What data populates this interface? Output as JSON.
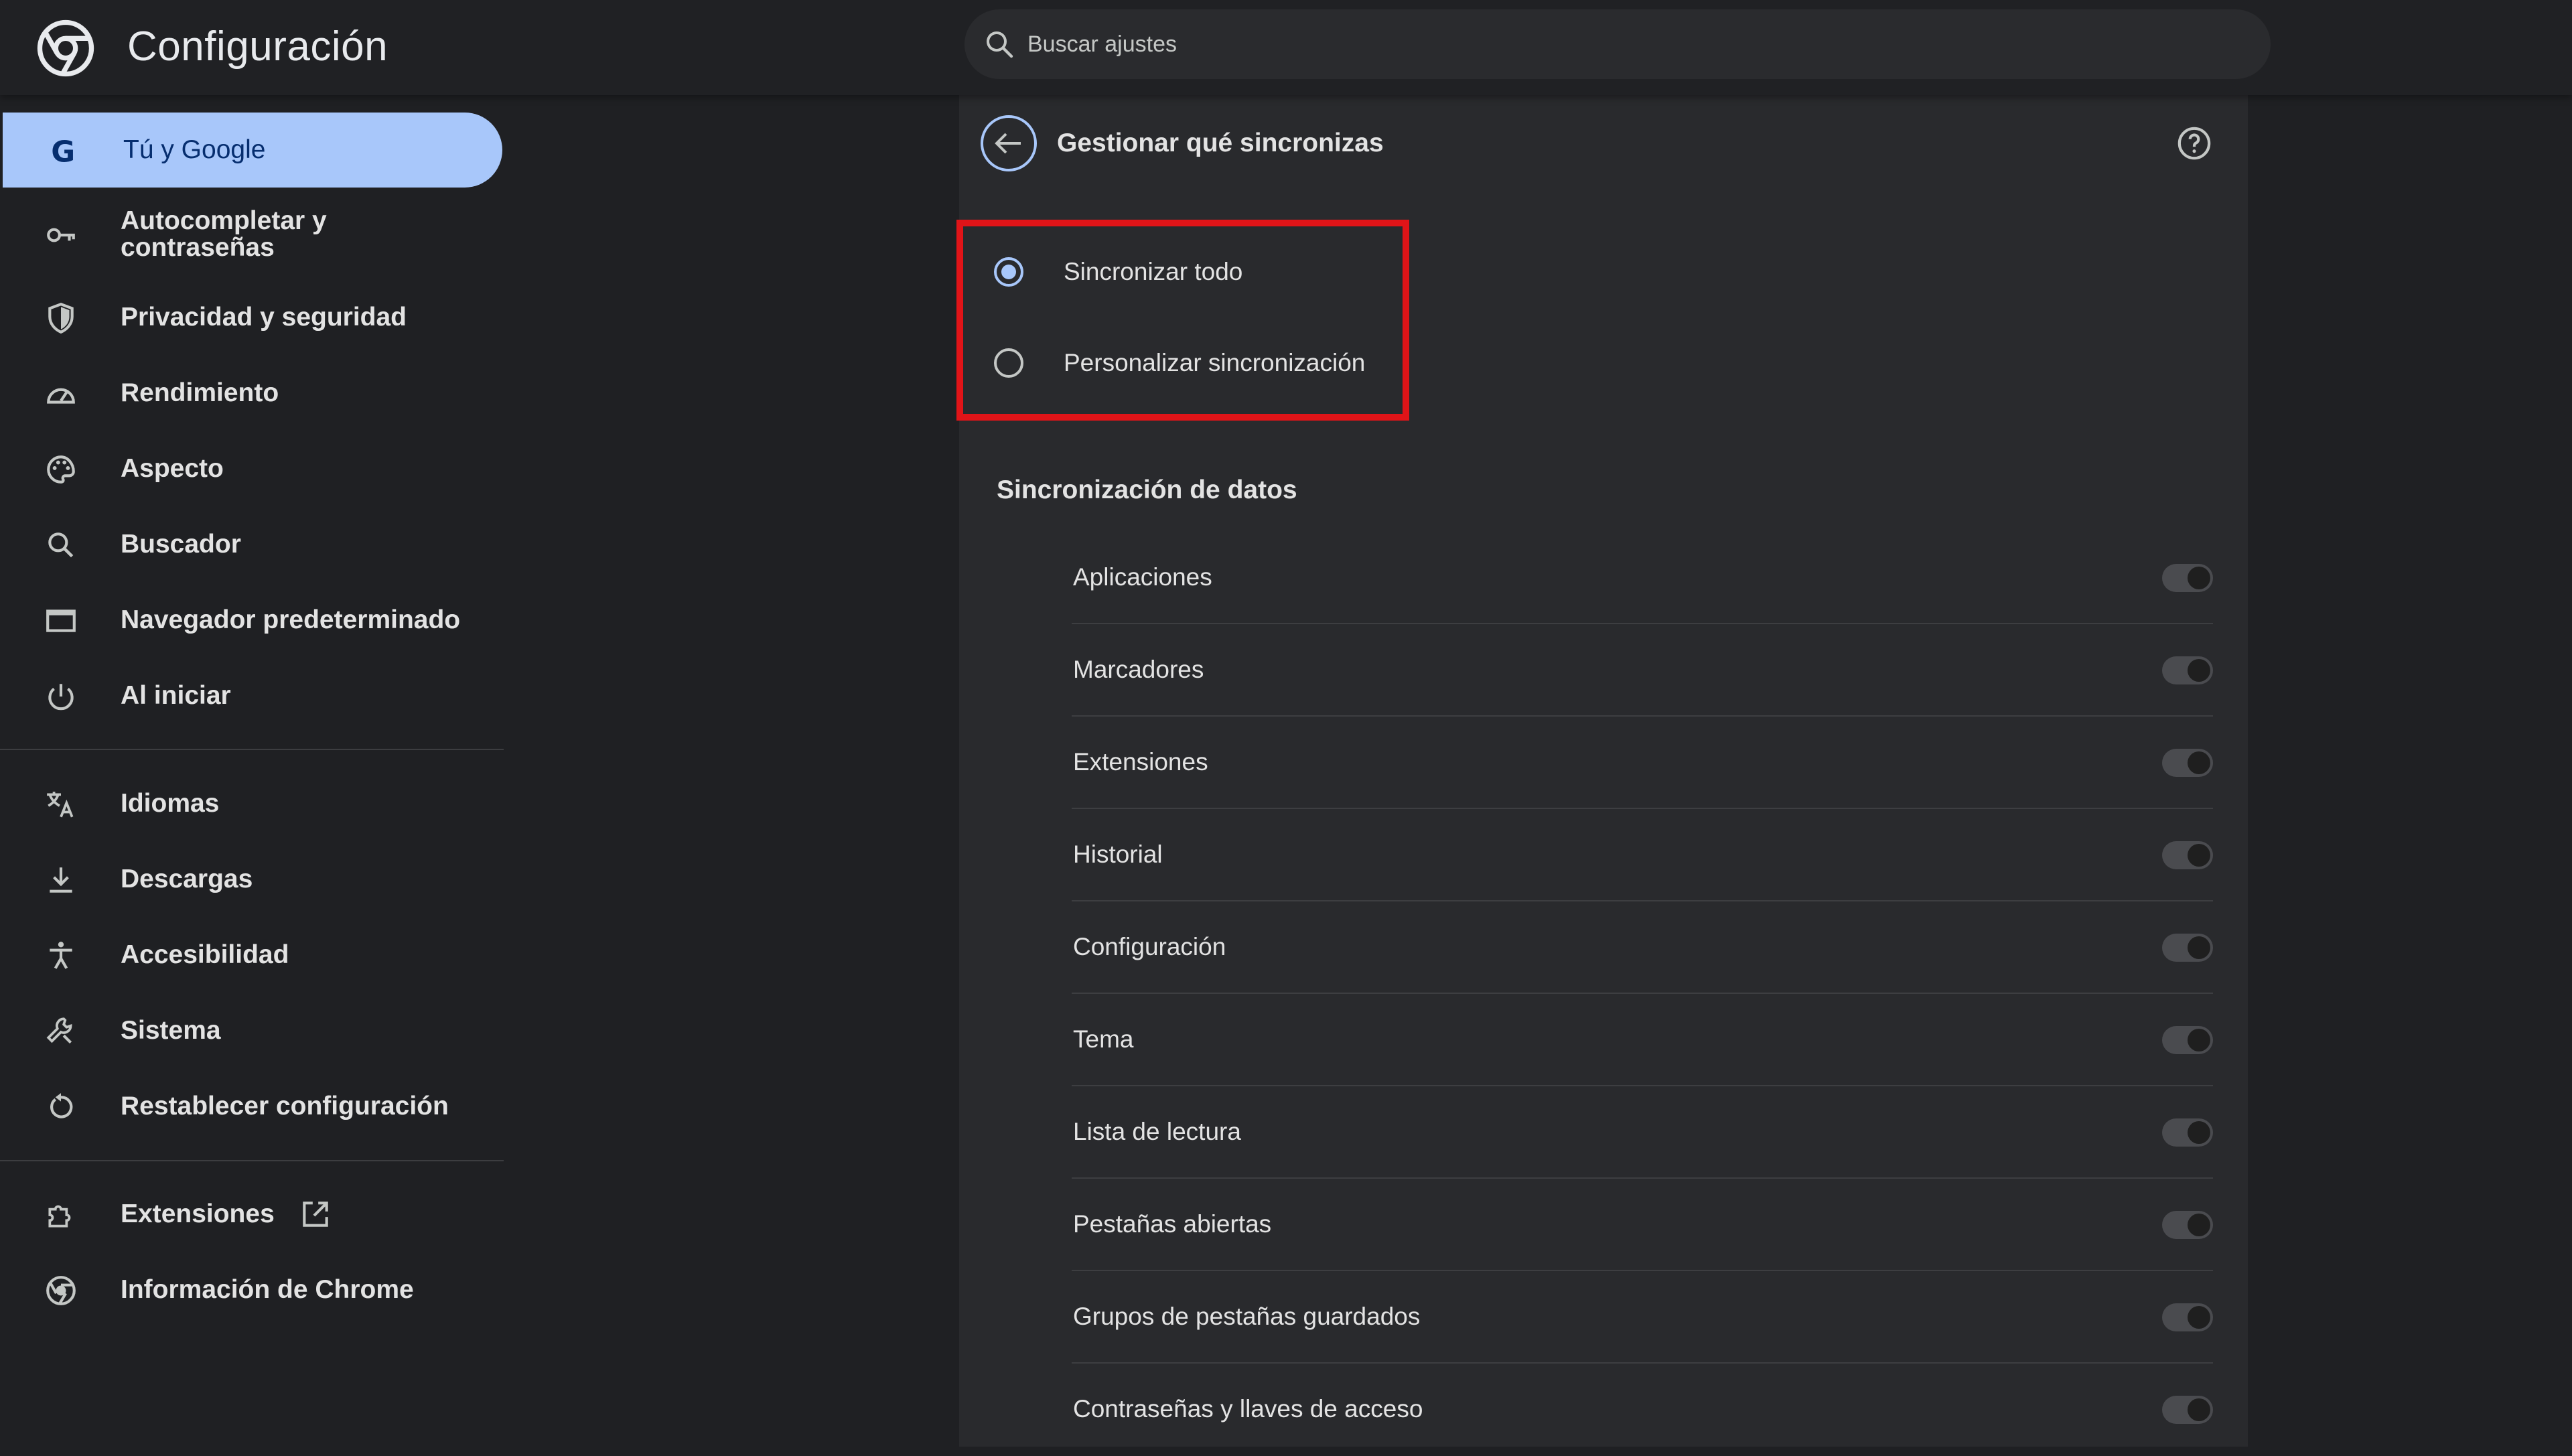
{
  "header": {
    "title": "Configuración",
    "search_placeholder": "Buscar ajustes"
  },
  "sidebar": {
    "items": [
      {
        "label": "Tú y Google",
        "icon": "google-g-icon",
        "active": true
      },
      {
        "label_line1": "Autocompletar y",
        "label_line2": "contraseñas",
        "icon": "key-icon"
      },
      {
        "label": "Privacidad y seguridad",
        "icon": "shield-icon"
      },
      {
        "label": "Rendimiento",
        "icon": "speedometer-icon"
      },
      {
        "label": "Aspecto",
        "icon": "palette-icon"
      },
      {
        "label": "Buscador",
        "icon": "search-icon"
      },
      {
        "label": "Navegador predeterminado",
        "icon": "browser-window-icon"
      },
      {
        "label": "Al iniciar",
        "icon": "power-icon"
      },
      {
        "label": "Idiomas",
        "icon": "translate-icon"
      },
      {
        "label": "Descargas",
        "icon": "download-icon"
      },
      {
        "label": "Accesibilidad",
        "icon": "accessibility-icon"
      },
      {
        "label": "Sistema",
        "icon": "wrench-icon"
      },
      {
        "label": "Restablecer configuración",
        "icon": "reset-icon"
      },
      {
        "label": "Extensiones",
        "icon": "puzzle-icon"
      },
      {
        "label": "Información de Chrome",
        "icon": "chrome-icon"
      }
    ]
  },
  "panel": {
    "title": "Gestionar qué sincronizas",
    "radios": [
      {
        "label": "Sincronizar todo",
        "checked": true
      },
      {
        "label": "Personalizar sincronización",
        "checked": false
      }
    ],
    "section_title": "Sincronización de datos",
    "sync_items": [
      {
        "label": "Aplicaciones",
        "enabled": false
      },
      {
        "label": "Marcadores",
        "enabled": false
      },
      {
        "label": "Extensiones",
        "enabled": false
      },
      {
        "label": "Historial",
        "enabled": false
      },
      {
        "label": "Configuración",
        "enabled": false
      },
      {
        "label": "Tema",
        "enabled": false
      },
      {
        "label": "Lista de lectura",
        "enabled": false
      },
      {
        "label": "Pestañas abiertas",
        "enabled": false
      },
      {
        "label": "Grupos de pestañas guardados",
        "enabled": false
      },
      {
        "label": "Contraseñas y llaves de acceso",
        "enabled": false
      }
    ]
  },
  "colors": {
    "accent": "#a8c7fa",
    "highlight_border": "#e01418",
    "background": "#1f2023",
    "panel": "#292a2d"
  }
}
